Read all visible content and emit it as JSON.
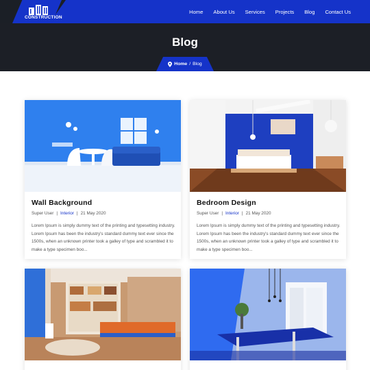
{
  "brand": {
    "logo_text": "CONSTRUCTION"
  },
  "nav": {
    "items": [
      {
        "label": "Home"
      },
      {
        "label": "About Us"
      },
      {
        "label": "Services"
      },
      {
        "label": "Projects"
      },
      {
        "label": "Blog"
      },
      {
        "label": "Contact Us"
      }
    ]
  },
  "hero": {
    "title": "Blog",
    "breadcrumb": {
      "home": "Home",
      "separator": "/",
      "current": "Blog"
    }
  },
  "posts": [
    {
      "title": "Wall Background",
      "author": "Super User",
      "category": "Interior",
      "date": "21 May 2020",
      "excerpt": "Lorem Ipsum is simply dummy text of the printing and typesetting industry. Lorem Ipsum has been the industry's standard dummy text ever since the 1500s, when an unknown printer took a galley of type and scrambled it to make a type specimen boo..."
    },
    {
      "title": "Bedroom Design",
      "author": "Super User",
      "category": "Interior",
      "date": "21 May 2020",
      "excerpt": "Lorem Ipsum is simply dummy text of the printing and typesetting industry. Lorem Ipsum has been the industry's standard dummy text ever since the 1500s, when an unknown printer took a galley of type and scrambled it to make a type specimen boo..."
    },
    {
      "title": "",
      "author": "",
      "category": "",
      "date": "",
      "excerpt": ""
    },
    {
      "title": "",
      "author": "",
      "category": "",
      "date": "",
      "excerpt": ""
    }
  ],
  "colors": {
    "accent": "#1533c9",
    "dark": "#1c1f26"
  }
}
